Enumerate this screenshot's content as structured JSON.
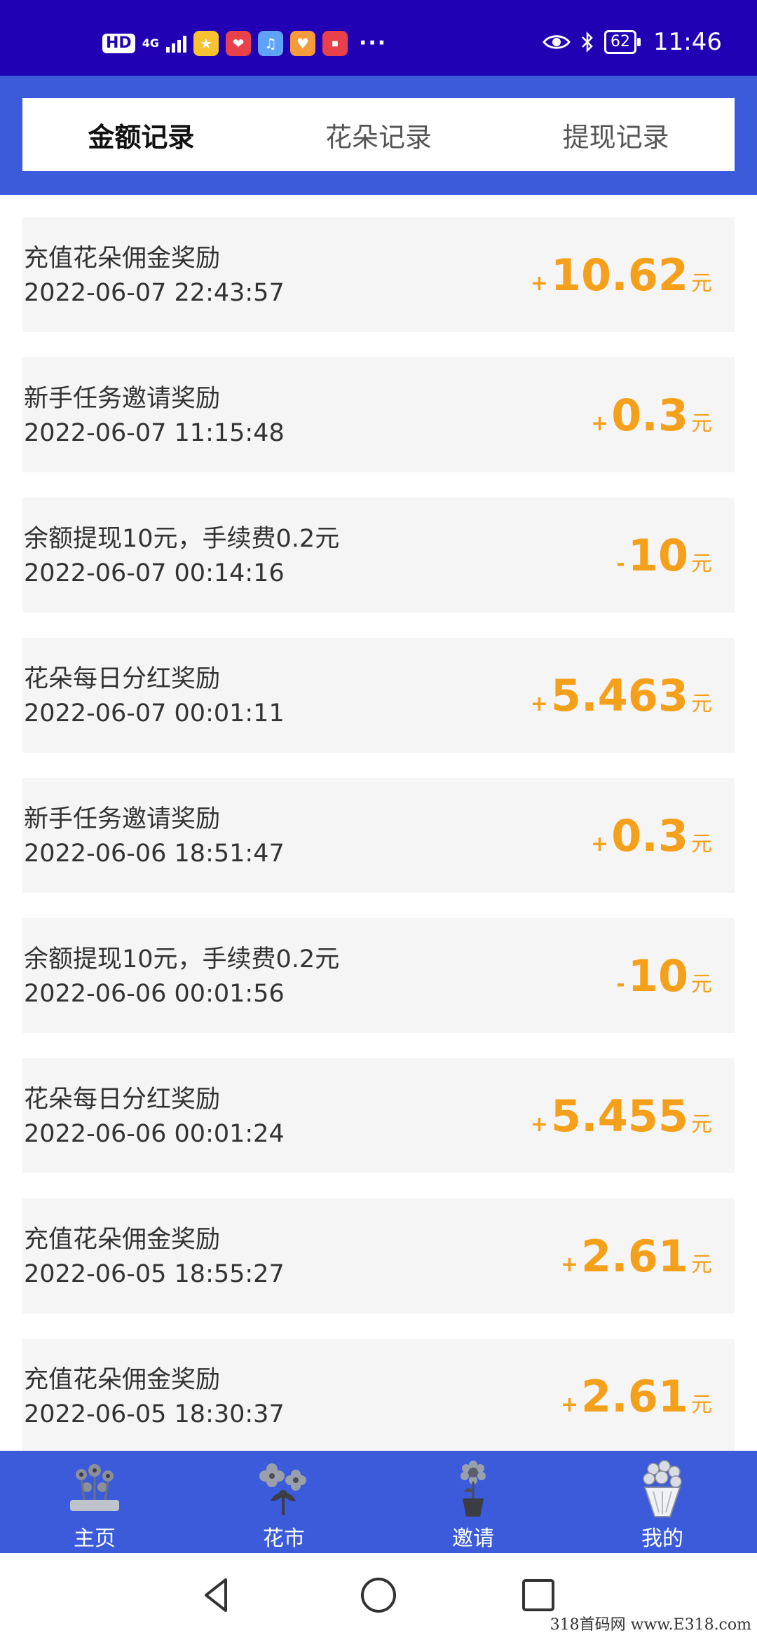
{
  "status_bar": {
    "hd": "HD",
    "network": "4G",
    "more": "···",
    "battery": "62",
    "time": "11:46"
  },
  "tabs": [
    {
      "label": "金额记录",
      "active": true
    },
    {
      "label": "花朵记录",
      "active": false
    },
    {
      "label": "提现记录",
      "active": false
    }
  ],
  "records": [
    {
      "title": "充值花朵佣金奖励",
      "time": "2022-06-07 22:43:57",
      "sign": "+",
      "amount": "10.62",
      "unit": "元"
    },
    {
      "title": "新手任务邀请奖励",
      "time": "2022-06-07 11:15:48",
      "sign": "+",
      "amount": "0.3",
      "unit": "元"
    },
    {
      "title": "余额提现10元，手续费0.2元",
      "time": "2022-06-07 00:14:16",
      "sign": "-",
      "amount": "10",
      "unit": "元"
    },
    {
      "title": "花朵每日分红奖励",
      "time": "2022-06-07 00:01:11",
      "sign": "+",
      "amount": "5.463",
      "unit": "元"
    },
    {
      "title": "新手任务邀请奖励",
      "time": "2022-06-06 18:51:47",
      "sign": "+",
      "amount": "0.3",
      "unit": "元"
    },
    {
      "title": "余额提现10元，手续费0.2元",
      "time": "2022-06-06 00:01:56",
      "sign": "-",
      "amount": "10",
      "unit": "元"
    },
    {
      "title": "花朵每日分红奖励",
      "time": "2022-06-06 00:01:24",
      "sign": "+",
      "amount": "5.455",
      "unit": "元"
    },
    {
      "title": "充值花朵佣金奖励",
      "time": "2022-06-05 18:55:27",
      "sign": "+",
      "amount": "2.61",
      "unit": "元"
    },
    {
      "title": "充值花朵佣金奖励",
      "time": "2022-06-05 18:30:37",
      "sign": "+",
      "amount": "2.61",
      "unit": "元"
    }
  ],
  "bottom_nav": [
    {
      "label": "主页",
      "icon": "flower-bed-icon"
    },
    {
      "label": "花市",
      "icon": "flower-market-icon"
    },
    {
      "label": "邀请",
      "icon": "potted-flower-icon"
    },
    {
      "label": "我的",
      "icon": "bouquet-icon"
    }
  ],
  "watermark": "318首码网 www.E318.com",
  "colors": {
    "status_bar": "#2200b3",
    "brand_blue": "#3b5bdb",
    "amount_orange": "#f5a01a",
    "card_bg": "#f5f5f5"
  }
}
